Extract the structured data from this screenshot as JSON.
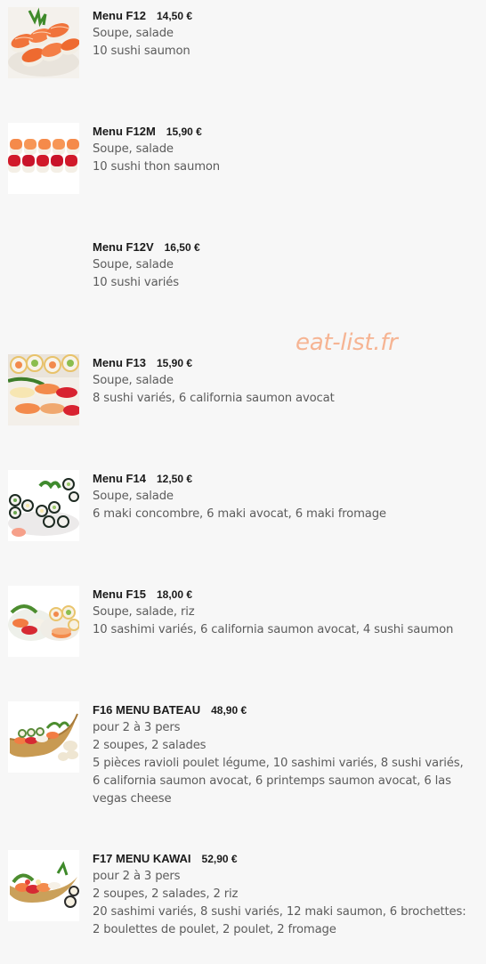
{
  "watermark": "eat-list.fr",
  "menus": [
    {
      "name": "Menu F12",
      "price": "14,50 €",
      "lines": [
        "Soupe, salade",
        "10 sushi saumon"
      ],
      "image": "salmon-sushi-image"
    },
    {
      "name": "Menu F12M",
      "price": "15,90 €",
      "lines": [
        "Soupe, salade",
        "10 sushi thon saumon"
      ],
      "image": "tuna-salmon-sushi-image"
    },
    {
      "name": "Menu F12V",
      "price": "16,50 €",
      "lines": [
        "Soupe, salade",
        "10 sushi variés"
      ],
      "image": ""
    },
    {
      "name": "Menu F13",
      "price": "15,90 €",
      "lines": [
        "Soupe, salade",
        "8 sushi variés, 6 california saumon avocat"
      ],
      "image": "assorted-sushi-california-image"
    },
    {
      "name": "Menu F14",
      "price": "12,50 €",
      "lines": [
        "Soupe, salade",
        "6 maki concombre, 6 maki avocat, 6 maki fromage"
      ],
      "image": "maki-rolls-image"
    },
    {
      "name": "Menu F15",
      "price": "18,00 €",
      "lines": [
        "Soupe, salade, riz",
        "10 sashimi variés, 6 california saumon avocat, 4 sushi saumon"
      ],
      "image": "sashimi-california-image"
    },
    {
      "name": "F16 MENU BATEAU",
      "price": "48,90 €",
      "lines": [
        "pour 2 à 3 pers",
        "2 soupes, 2 salades",
        "5 pièces ravioli poulet légume, 10 sashimi variés, 8 sushi variés,",
        "6 california saumon avocat, 6 printemps saumon avocat, 6 las",
        "vegas cheese"
      ],
      "image": "sushi-boat-image"
    },
    {
      "name": "F17 MENU KAWAI",
      "price": "52,90 €",
      "lines": [
        "pour 2 à 3 pers",
        "2 soupes, 2 salades, 2 riz",
        "20 sashimi variés, 8 sushi variés, 12 maki saumon, 6 brochettes:",
        "2 boulettes de poulet, 2 poulet, 2 fromage"
      ],
      "image": "sashimi-boat-image"
    }
  ]
}
